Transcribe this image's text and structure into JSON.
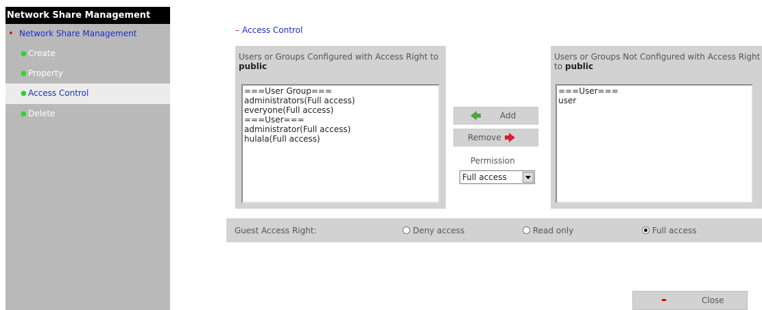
{
  "sidebar": {
    "title": "Network Share Management",
    "main_item": "Network Share Management",
    "items": [
      {
        "label": "Create"
      },
      {
        "label": "Property"
      },
      {
        "label": "Access Control"
      },
      {
        "label": "Delete"
      }
    ]
  },
  "section": {
    "title": "Access Control"
  },
  "configured": {
    "header": "Users or Groups Configured with Access Right to",
    "share": "public",
    "entries": [
      "===User Group===",
      "administrators(Full access)",
      "everyone(Full access)",
      "===User===",
      "administrator(Full access)",
      "hulala(Full access)"
    ]
  },
  "not_configured": {
    "header": "Users or Groups Not Configured with Access Right to",
    "share": "public",
    "entries": [
      "===User===",
      "user"
    ]
  },
  "buttons": {
    "add": "Add",
    "remove": "Remove",
    "close": "Close"
  },
  "permission": {
    "label": "Permission",
    "selected": "Full access"
  },
  "guest": {
    "label": "Guest Access Right:",
    "options": [
      "Deny access",
      "Read only",
      "Full access"
    ],
    "selected": "Full access"
  }
}
